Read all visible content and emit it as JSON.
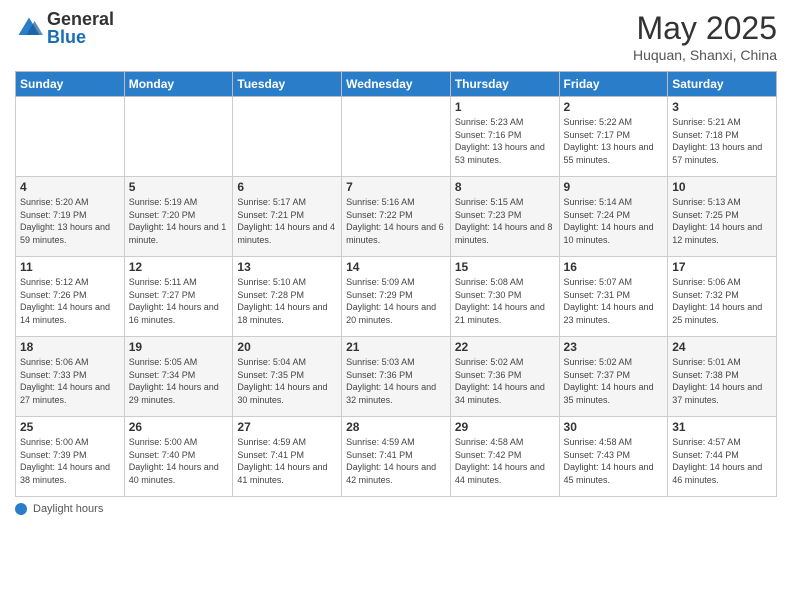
{
  "header": {
    "logo_general": "General",
    "logo_blue": "Blue",
    "month_title": "May 2025",
    "location": "Huquan, Shanxi, China"
  },
  "days_of_week": [
    "Sunday",
    "Monday",
    "Tuesday",
    "Wednesday",
    "Thursday",
    "Friday",
    "Saturday"
  ],
  "footer": {
    "label": "Daylight hours"
  },
  "weeks": [
    [
      {
        "day": "",
        "sunrise": "",
        "sunset": "",
        "daylight": ""
      },
      {
        "day": "",
        "sunrise": "",
        "sunset": "",
        "daylight": ""
      },
      {
        "day": "",
        "sunrise": "",
        "sunset": "",
        "daylight": ""
      },
      {
        "day": "",
        "sunrise": "",
        "sunset": "",
        "daylight": ""
      },
      {
        "day": "1",
        "sunrise": "Sunrise: 5:23 AM",
        "sunset": "Sunset: 7:16 PM",
        "daylight": "Daylight: 13 hours and 53 minutes."
      },
      {
        "day": "2",
        "sunrise": "Sunrise: 5:22 AM",
        "sunset": "Sunset: 7:17 PM",
        "daylight": "Daylight: 13 hours and 55 minutes."
      },
      {
        "day": "3",
        "sunrise": "Sunrise: 5:21 AM",
        "sunset": "Sunset: 7:18 PM",
        "daylight": "Daylight: 13 hours and 57 minutes."
      }
    ],
    [
      {
        "day": "4",
        "sunrise": "Sunrise: 5:20 AM",
        "sunset": "Sunset: 7:19 PM",
        "daylight": "Daylight: 13 hours and 59 minutes."
      },
      {
        "day": "5",
        "sunrise": "Sunrise: 5:19 AM",
        "sunset": "Sunset: 7:20 PM",
        "daylight": "Daylight: 14 hours and 1 minute."
      },
      {
        "day": "6",
        "sunrise": "Sunrise: 5:17 AM",
        "sunset": "Sunset: 7:21 PM",
        "daylight": "Daylight: 14 hours and 4 minutes."
      },
      {
        "day": "7",
        "sunrise": "Sunrise: 5:16 AM",
        "sunset": "Sunset: 7:22 PM",
        "daylight": "Daylight: 14 hours and 6 minutes."
      },
      {
        "day": "8",
        "sunrise": "Sunrise: 5:15 AM",
        "sunset": "Sunset: 7:23 PM",
        "daylight": "Daylight: 14 hours and 8 minutes."
      },
      {
        "day": "9",
        "sunrise": "Sunrise: 5:14 AM",
        "sunset": "Sunset: 7:24 PM",
        "daylight": "Daylight: 14 hours and 10 minutes."
      },
      {
        "day": "10",
        "sunrise": "Sunrise: 5:13 AM",
        "sunset": "Sunset: 7:25 PM",
        "daylight": "Daylight: 14 hours and 12 minutes."
      }
    ],
    [
      {
        "day": "11",
        "sunrise": "Sunrise: 5:12 AM",
        "sunset": "Sunset: 7:26 PM",
        "daylight": "Daylight: 14 hours and 14 minutes."
      },
      {
        "day": "12",
        "sunrise": "Sunrise: 5:11 AM",
        "sunset": "Sunset: 7:27 PM",
        "daylight": "Daylight: 14 hours and 16 minutes."
      },
      {
        "day": "13",
        "sunrise": "Sunrise: 5:10 AM",
        "sunset": "Sunset: 7:28 PM",
        "daylight": "Daylight: 14 hours and 18 minutes."
      },
      {
        "day": "14",
        "sunrise": "Sunrise: 5:09 AM",
        "sunset": "Sunset: 7:29 PM",
        "daylight": "Daylight: 14 hours and 20 minutes."
      },
      {
        "day": "15",
        "sunrise": "Sunrise: 5:08 AM",
        "sunset": "Sunset: 7:30 PM",
        "daylight": "Daylight: 14 hours and 21 minutes."
      },
      {
        "day": "16",
        "sunrise": "Sunrise: 5:07 AM",
        "sunset": "Sunset: 7:31 PM",
        "daylight": "Daylight: 14 hours and 23 minutes."
      },
      {
        "day": "17",
        "sunrise": "Sunrise: 5:06 AM",
        "sunset": "Sunset: 7:32 PM",
        "daylight": "Daylight: 14 hours and 25 minutes."
      }
    ],
    [
      {
        "day": "18",
        "sunrise": "Sunrise: 5:06 AM",
        "sunset": "Sunset: 7:33 PM",
        "daylight": "Daylight: 14 hours and 27 minutes."
      },
      {
        "day": "19",
        "sunrise": "Sunrise: 5:05 AM",
        "sunset": "Sunset: 7:34 PM",
        "daylight": "Daylight: 14 hours and 29 minutes."
      },
      {
        "day": "20",
        "sunrise": "Sunrise: 5:04 AM",
        "sunset": "Sunset: 7:35 PM",
        "daylight": "Daylight: 14 hours and 30 minutes."
      },
      {
        "day": "21",
        "sunrise": "Sunrise: 5:03 AM",
        "sunset": "Sunset: 7:36 PM",
        "daylight": "Daylight: 14 hours and 32 minutes."
      },
      {
        "day": "22",
        "sunrise": "Sunrise: 5:02 AM",
        "sunset": "Sunset: 7:36 PM",
        "daylight": "Daylight: 14 hours and 34 minutes."
      },
      {
        "day": "23",
        "sunrise": "Sunrise: 5:02 AM",
        "sunset": "Sunset: 7:37 PM",
        "daylight": "Daylight: 14 hours and 35 minutes."
      },
      {
        "day": "24",
        "sunrise": "Sunrise: 5:01 AM",
        "sunset": "Sunset: 7:38 PM",
        "daylight": "Daylight: 14 hours and 37 minutes."
      }
    ],
    [
      {
        "day": "25",
        "sunrise": "Sunrise: 5:00 AM",
        "sunset": "Sunset: 7:39 PM",
        "daylight": "Daylight: 14 hours and 38 minutes."
      },
      {
        "day": "26",
        "sunrise": "Sunrise: 5:00 AM",
        "sunset": "Sunset: 7:40 PM",
        "daylight": "Daylight: 14 hours and 40 minutes."
      },
      {
        "day": "27",
        "sunrise": "Sunrise: 4:59 AM",
        "sunset": "Sunset: 7:41 PM",
        "daylight": "Daylight: 14 hours and 41 minutes."
      },
      {
        "day": "28",
        "sunrise": "Sunrise: 4:59 AM",
        "sunset": "Sunset: 7:41 PM",
        "daylight": "Daylight: 14 hours and 42 minutes."
      },
      {
        "day": "29",
        "sunrise": "Sunrise: 4:58 AM",
        "sunset": "Sunset: 7:42 PM",
        "daylight": "Daylight: 14 hours and 44 minutes."
      },
      {
        "day": "30",
        "sunrise": "Sunrise: 4:58 AM",
        "sunset": "Sunset: 7:43 PM",
        "daylight": "Daylight: 14 hours and 45 minutes."
      },
      {
        "day": "31",
        "sunrise": "Sunrise: 4:57 AM",
        "sunset": "Sunset: 7:44 PM",
        "daylight": "Daylight: 14 hours and 46 minutes."
      }
    ]
  ]
}
